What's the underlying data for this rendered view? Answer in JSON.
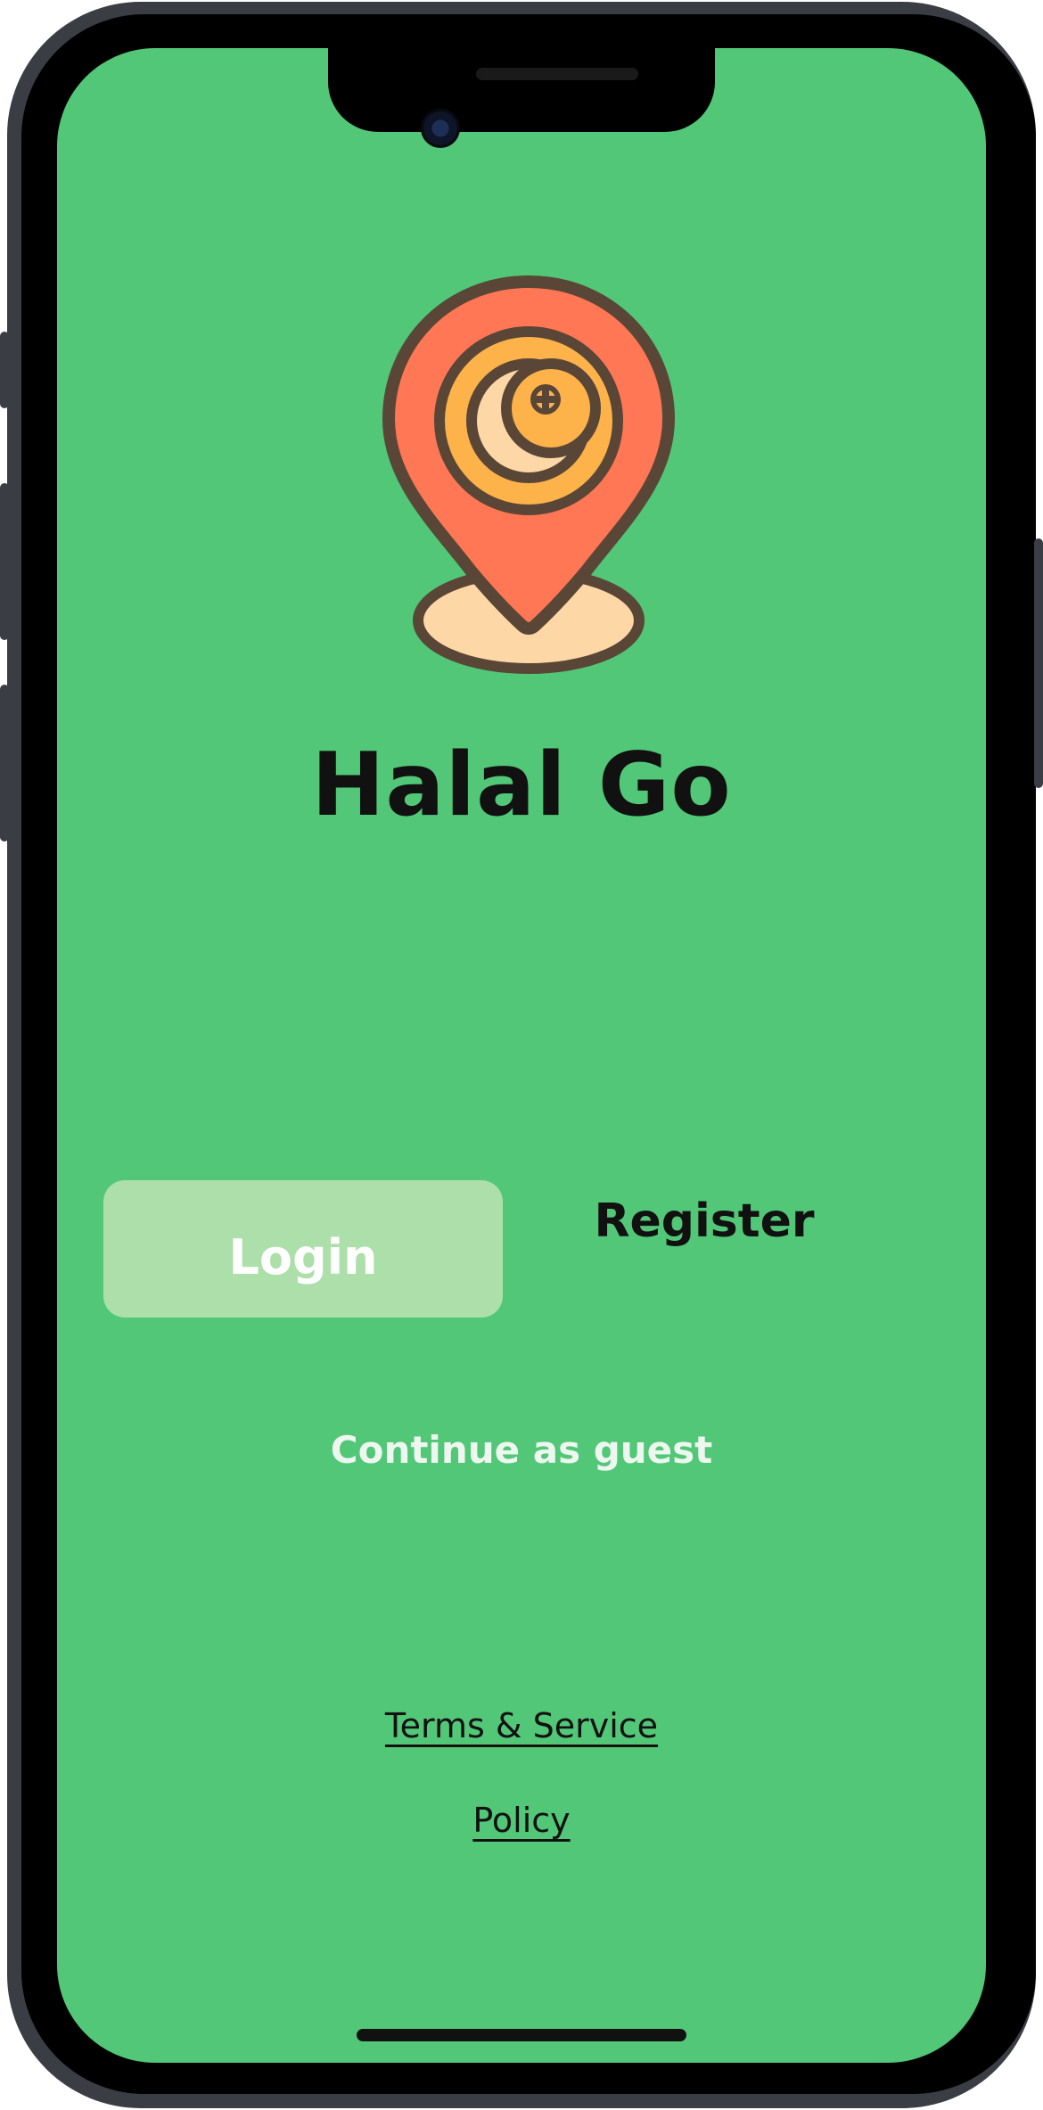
{
  "app": {
    "title": "Halal Go"
  },
  "auth": {
    "login_label": "Login",
    "register_label": "Register",
    "guest_label": "Continue as guest"
  },
  "footer": {
    "terms_label": "Terms & Service",
    "policy_label": "Policy"
  },
  "logo": {
    "icon": "location-pin-crescent-icon"
  },
  "colors": {
    "background": "#52c778",
    "login_button": "#addfaa",
    "pin": "#ff7754",
    "inner_circle": "#fdb24a",
    "crescent": "#fdd7a5",
    "pin_base": "#fdd7a5",
    "outline": "#5a4636"
  }
}
